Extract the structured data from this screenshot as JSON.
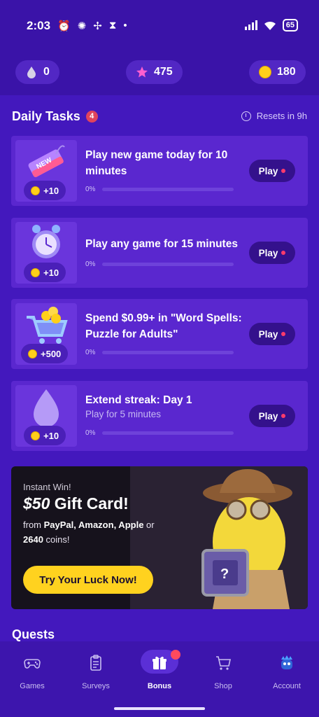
{
  "status_bar": {
    "time": "2:03",
    "battery": "65"
  },
  "currencies": [
    {
      "icon": "drop-icon",
      "value": "0"
    },
    {
      "icon": "star-icon",
      "value": "475"
    },
    {
      "icon": "coin-icon",
      "value": "180"
    }
  ],
  "daily_tasks": {
    "title": "Daily Tasks",
    "count": "4",
    "resets": "Resets in 9h",
    "items": [
      {
        "title": "Play new game today for 10 minutes",
        "subtitle": "",
        "reward": "+10",
        "progress": "0%",
        "progress_value": 0,
        "button": "Play"
      },
      {
        "title": "Play any game for 15 minutes",
        "subtitle": "",
        "reward": "+10",
        "progress": "0%",
        "progress_value": 0,
        "button": "Play"
      },
      {
        "title": "Spend $0.99+ in \"Word Spells: Puzzle for Adults\"",
        "subtitle": "",
        "reward": "+500",
        "progress": "0%",
        "progress_value": 0,
        "button": "Play"
      },
      {
        "title": "Extend streak: Day 1",
        "subtitle": "Play for 5 minutes",
        "reward": "+10",
        "progress": "0%",
        "progress_value": 0,
        "button": "Play"
      }
    ]
  },
  "promo": {
    "kicker": "Instant Win!",
    "amount": "$50",
    "title_rest": " Gift Card!",
    "from": "from ",
    "brands": "PayPal, Amazon, Apple",
    "or": " or",
    "coins_amount": "2640",
    "coins_text": " coins!",
    "button": "Try Your Luck Now!"
  },
  "quests_title": "Quests",
  "nav": [
    {
      "label": "Games",
      "icon": "gamepad-icon"
    },
    {
      "label": "Surveys",
      "icon": "clipboard-icon"
    },
    {
      "label": "Bonus",
      "icon": "gift-icon",
      "active": true
    },
    {
      "label": "Shop",
      "icon": "cart-icon"
    },
    {
      "label": "Account",
      "icon": "avatar-icon"
    }
  ],
  "colors": {
    "background": "#3a13a8",
    "card": "#5a27cf",
    "accent_yellow": "#ffd21f",
    "badge_red": "#e0445c"
  }
}
